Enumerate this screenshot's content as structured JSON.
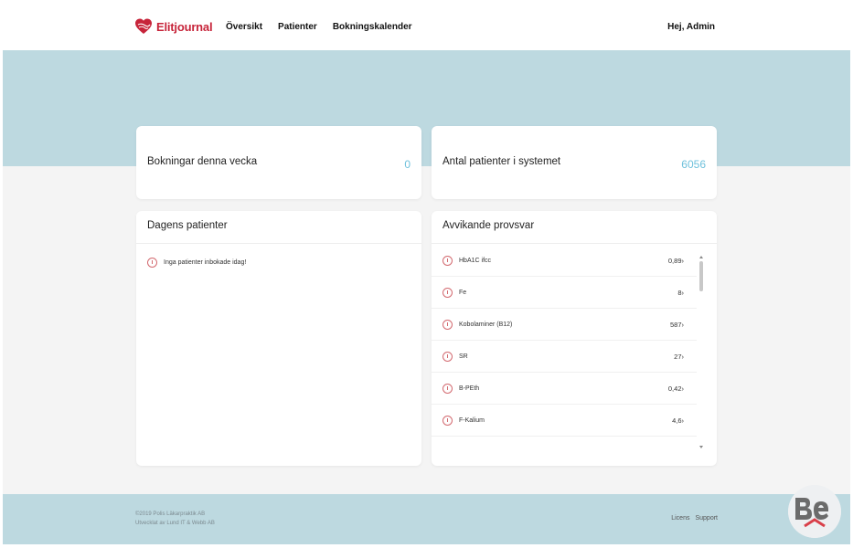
{
  "header": {
    "brand": "Elitjournal",
    "nav": [
      "Översikt",
      "Patienter",
      "Bokningskalender"
    ],
    "greeting": "Hej, Admin"
  },
  "stats": {
    "bookings_label": "Bokningar denna vecka",
    "bookings_value": "0",
    "patients_label": "Antal patienter i systemet",
    "patients_value": "6056"
  },
  "todays_patients": {
    "title": "Dagens patienter",
    "empty_message": "Inga patienter inbokade idag!"
  },
  "deviating_results": {
    "title": "Avvikande provsvar",
    "items": [
      {
        "name": "HbA1C ifcc",
        "value": "0,89›"
      },
      {
        "name": "Fe",
        "value": "8›"
      },
      {
        "name": "Kobolaminer (B12)",
        "value": "587›"
      },
      {
        "name": "SR",
        "value": "27›"
      },
      {
        "name": "B-PEth",
        "value": "0,42›"
      },
      {
        "name": "F-Kalium",
        "value": "4,6›"
      }
    ]
  },
  "footer": {
    "copyright": "©2019 Polis Läkarpraktik AB",
    "developer": "Utvecklat av Lund IT & Webb AB",
    "links": [
      "Licens",
      "Support"
    ]
  },
  "colors": {
    "brand": "#c7243a",
    "hero": "#bdd9e0",
    "stat_value": "#6fc1dc",
    "alert_icon": "#d36a70"
  }
}
